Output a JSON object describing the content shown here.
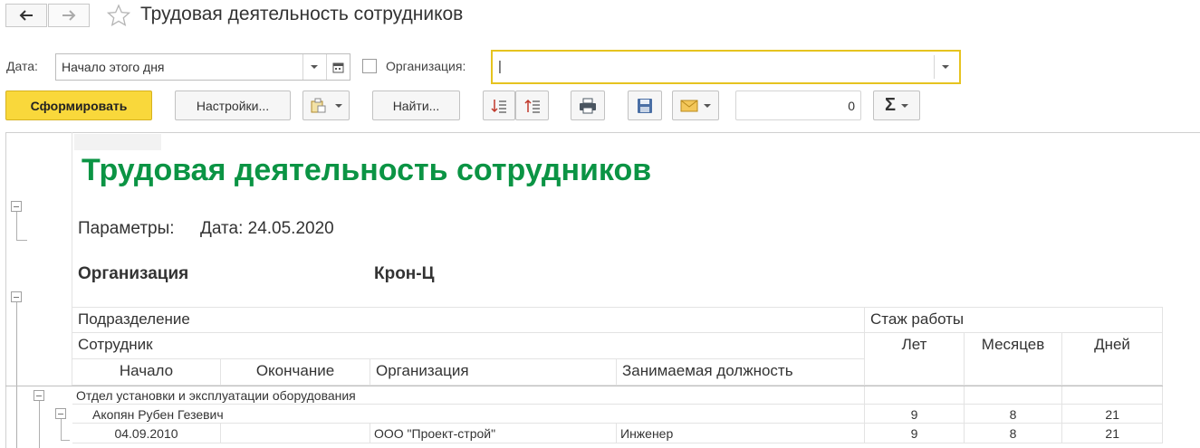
{
  "window": {
    "title": "Трудовая деятельность сотрудников",
    "back_icon": "arrow-left-icon",
    "forward_icon": "arrow-right-icon",
    "favorite_icon": "star-icon"
  },
  "filters": {
    "date_label": "Дата:",
    "date_value": "Начало этого дня",
    "org_label": "Организация:",
    "org_checked": false,
    "org_value": "|"
  },
  "toolbar": {
    "generate": "Сформировать",
    "settings": "Настройки...",
    "find": "Найти...",
    "counter": "0",
    "sum_symbol": "Σ"
  },
  "report": {
    "title": "Трудовая деятельность сотрудников",
    "params_label": "Параметры:",
    "params_value": "Дата: 24.05.2020",
    "org_label": "Организация",
    "org_value": "Крон-Ц",
    "headers": {
      "department": "Подразделение",
      "employee": "Сотрудник",
      "start": "Начало",
      "end": "Окончание",
      "organization": "Организация",
      "position": "Занимаемая должность",
      "experience": "Стаж работы",
      "years": "Лет",
      "months": "Месяцев",
      "days": "Дней"
    },
    "rows": [
      {
        "department": "Отдел установки и эксплуатации оборудования"
      },
      {
        "employee": "Акопян Рубен Гезевич",
        "years": "9",
        "months": "8",
        "days": "21"
      },
      {
        "start": "04.09.2010",
        "end": "",
        "organization": "ООО \"Проект-строй\"",
        "position": "Инженер",
        "years": "9",
        "months": "8",
        "days": "21"
      }
    ]
  },
  "colors": {
    "title_green": "#0b9444",
    "primary_button": "#f9d83b",
    "focus_border": "#e6c31f"
  }
}
